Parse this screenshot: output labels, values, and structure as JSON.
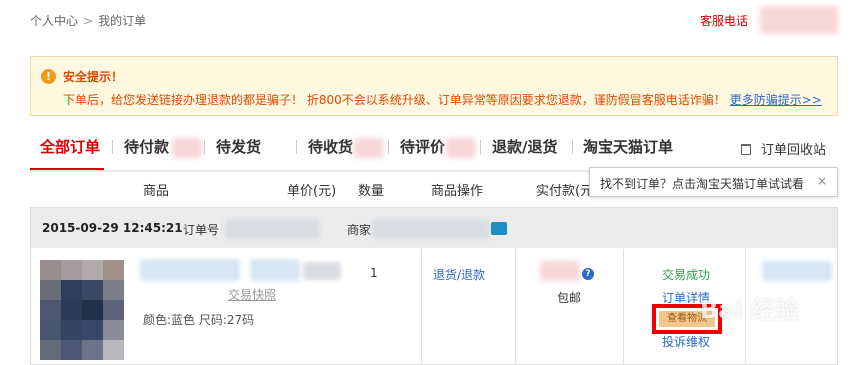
{
  "breadcrumb": {
    "home": "个人中心",
    "separator": ">",
    "current": "我的订单"
  },
  "service_phone": "客服电话",
  "notice": {
    "title": "安全提示！",
    "body": "下单后，给您发送链接办理退款的都是骗子！ 折800不会以系统升级、订单异常等原因要求您退款，谨防假冒客服电话诈骗！",
    "link": "更多防骗提示>>",
    "icon": "warning-icon"
  },
  "tabs": [
    {
      "label": "全部订单"
    },
    {
      "label": "待付款"
    },
    {
      "label": "待发货"
    },
    {
      "label": "待收货"
    },
    {
      "label": "待评价"
    },
    {
      "label": "退款/退货"
    },
    {
      "label": "淘宝天猫订单"
    }
  ],
  "recycle_bin": "订单回收站",
  "columns": {
    "product": "商品",
    "unit_price": "单价(元)",
    "quantity": "数量",
    "operation": "商品操作",
    "paid": "实付款(元"
  },
  "tooltip": {
    "text": "找不到订单？点击淘宝天猫订单试试看",
    "close": "×"
  },
  "order": {
    "date": "2015-09-29 12:45:21",
    "order_no_label": "订单号",
    "seller_label": "商家",
    "quantity": "1",
    "refund": "退货/退款",
    "snapshot": "交易快照",
    "spec": "颜色:蓝色 尺码:27码",
    "shipping": "包邮",
    "status": "交易成功",
    "detail": "订单详情",
    "logistics": "查看物流",
    "complaint": "投诉维权"
  },
  "watermark": "Bai 经验"
}
